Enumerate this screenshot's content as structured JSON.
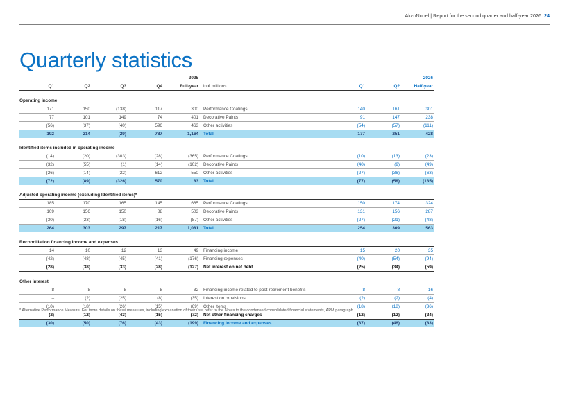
{
  "header": {
    "text": "AkzoNobel | Report for the second quarter and half-year 2026",
    "page_number": "24"
  },
  "title": "Quarterly statistics",
  "table": {
    "year_2025": "2025",
    "year_2026": "2026",
    "columns": {
      "q1": "Q1",
      "q2": "Q2",
      "q3": "Q3",
      "q4": "Q4",
      "fy": "Full-year",
      "unit": "in € millions",
      "q1_26": "Q1",
      "q2_26": "Q2",
      "hy": "Half-year"
    },
    "sections": [
      {
        "title": "Operating income",
        "rows": [
          {
            "type": "data",
            "v": [
              "171",
              "150",
              "(138)",
              "117",
              "300"
            ],
            "label": "Performance Coatings",
            "w": [
              "140",
              "161",
              "301"
            ]
          },
          {
            "type": "data",
            "v": [
              "77",
              "101",
              "149",
              "74",
              "401"
            ],
            "label": "Decorative Paints",
            "w": [
              "91",
              "147",
              "238"
            ]
          },
          {
            "type": "data",
            "v": [
              "(56)",
              "(37)",
              "(40)",
              "596",
              "463"
            ],
            "label": "Other activities",
            "w": [
              "(54)",
              "(57)",
              "(111)"
            ]
          },
          {
            "type": "total",
            "v": [
              "192",
              "214",
              "(29)",
              "787",
              "1,164"
            ],
            "label": "Total",
            "w": [
              "177",
              "251",
              "428"
            ]
          }
        ]
      },
      {
        "title": "Identified items included in operating income",
        "rows": [
          {
            "type": "data",
            "v": [
              "(14)",
              "(20)",
              "(303)",
              "(28)",
              "(365)"
            ],
            "label": "Performance Coatings",
            "w": [
              "(10)",
              "(13)",
              "(23)"
            ]
          },
          {
            "type": "data",
            "v": [
              "(32)",
              "(55)",
              "(1)",
              "(14)",
              "(102)"
            ],
            "label": "Decorative Paints",
            "w": [
              "(40)",
              "(9)",
              "(49)"
            ]
          },
          {
            "type": "data",
            "v": [
              "(26)",
              "(14)",
              "(22)",
              "612",
              "550"
            ],
            "label": "Other activities",
            "w": [
              "(27)",
              "(36)",
              "(63)"
            ]
          },
          {
            "type": "total",
            "v": [
              "(72)",
              "(89)",
              "(326)",
              "570",
              "83"
            ],
            "label": "Total",
            "w": [
              "(77)",
              "(58)",
              "(135)"
            ]
          }
        ]
      },
      {
        "title": "Adjusted operating income (excluding Identified items)*",
        "rows": [
          {
            "type": "data",
            "v": [
              "185",
              "170",
              "165",
              "145",
              "665"
            ],
            "label": "Performance Coatings",
            "w": [
              "150",
              "174",
              "324"
            ]
          },
          {
            "type": "data",
            "v": [
              "109",
              "156",
              "150",
              "88",
              "503"
            ],
            "label": "Decorative Paints",
            "w": [
              "131",
              "156",
              "287"
            ]
          },
          {
            "type": "data",
            "v": [
              "(30)",
              "(23)",
              "(18)",
              "(16)",
              "(87)"
            ],
            "label": "Other activities",
            "w": [
              "(27)",
              "(21)",
              "(48)"
            ]
          },
          {
            "type": "total",
            "v": [
              "264",
              "303",
              "297",
              "217",
              "1,081"
            ],
            "label": "Total",
            "w": [
              "254",
              "309",
              "563"
            ]
          }
        ]
      },
      {
        "title": "Reconciliation financing income and expenses",
        "rows": [
          {
            "type": "data",
            "v": [
              "14",
              "10",
              "12",
              "13",
              "49"
            ],
            "label": "Financing income",
            "w": [
              "15",
              "20",
              "35"
            ]
          },
          {
            "type": "data",
            "v": [
              "(42)",
              "(48)",
              "(45)",
              "(41)",
              "(176)"
            ],
            "label": "Financing expenses",
            "w": [
              "(40)",
              "(54)",
              "(94)"
            ]
          },
          {
            "type": "bold",
            "v": [
              "(28)",
              "(38)",
              "(33)",
              "(28)",
              "(127)"
            ],
            "label": "Net interest on net debt",
            "w": [
              "(25)",
              "(34)",
              "(59)"
            ]
          }
        ]
      },
      {
        "title": "Other interest",
        "rows": [
          {
            "type": "data",
            "v": [
              "8",
              "8",
              "8",
              "8",
              "32"
            ],
            "label": "Financing income related to post-retirement benefits",
            "w": [
              "8",
              "8",
              "16"
            ]
          },
          {
            "type": "data",
            "v": [
              "–",
              "(2)",
              "(25)",
              "(8)",
              "(35)"
            ],
            "label": "Interest on provisions",
            "w": [
              "(2)",
              "(2)",
              "(4)"
            ]
          },
          {
            "type": "data",
            "v": [
              "(10)",
              "(18)",
              "(26)",
              "(15)",
              "(69)"
            ],
            "label": "Other items",
            "w": [
              "(18)",
              "(18)",
              "(36)"
            ]
          },
          {
            "type": "bold",
            "v": [
              "(2)",
              "(12)",
              "(43)",
              "(15)",
              "(72)"
            ],
            "label": "Net other financing charges",
            "w": [
              "(12)",
              "(12)",
              "(24)"
            ]
          },
          {
            "type": "total",
            "v": [
              "(30)",
              "(50)",
              "(76)",
              "(43)",
              "(199)"
            ],
            "label": "Financing income and expenses",
            "w": [
              "(37)",
              "(46)",
              "(83)"
            ]
          }
        ]
      }
    ]
  },
  "footnote": "* Alternative Performance Measure: For more details on these measures, including explanation of their use, refer to the Notes to the condensed consolidated financial statements, APM paragraph."
}
